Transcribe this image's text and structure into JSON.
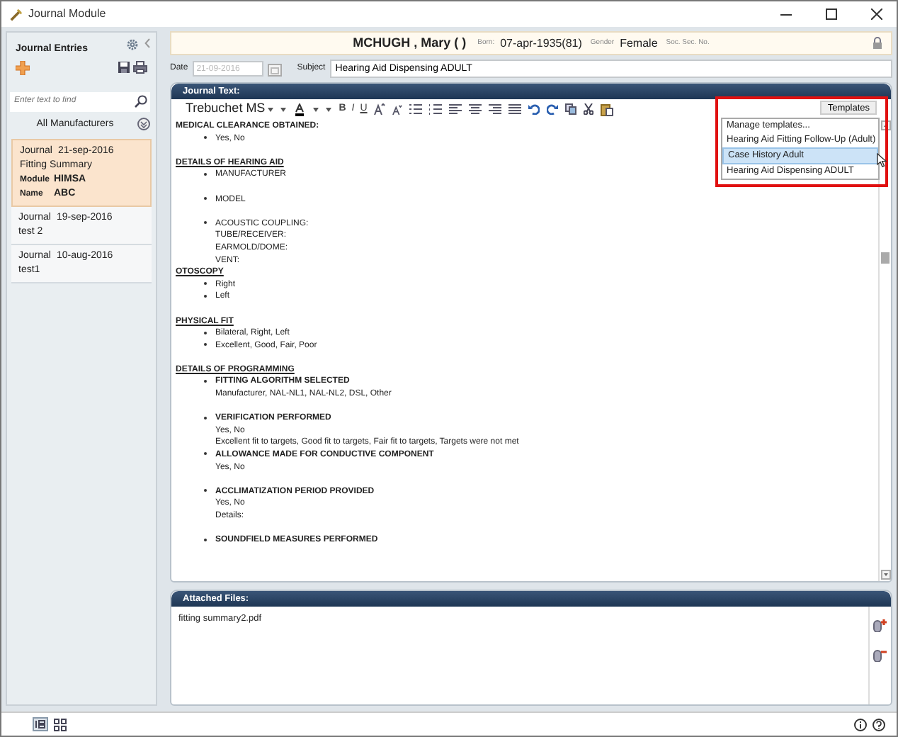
{
  "window": {
    "title": "Journal Module"
  },
  "sidebar": {
    "title": "Journal Entries",
    "search": {
      "placeholder": "Enter text to find"
    },
    "filter": "All Manufacturers",
    "entries": [
      {
        "label": "Journal",
        "date": "21-sep-2016",
        "subject": "Fitting Summary",
        "selected": true,
        "details": [
          {
            "key": "Module",
            "value": "HIMSA"
          },
          {
            "key": "Name",
            "value": "ABC"
          }
        ]
      },
      {
        "label": "Journal",
        "date": "19-sep-2016",
        "subject": "test 2",
        "selected": false
      },
      {
        "label": "Journal",
        "date": "10-aug-2016",
        "subject": "test1",
        "selected": false
      }
    ]
  },
  "patient": {
    "name": "MCHUGH , Mary ( )",
    "born_label": "Born:",
    "born": "07-apr-1935(81)",
    "gender_label": "Gender",
    "gender": "Female",
    "ssn_label": "Soc. Sec. No."
  },
  "date": {
    "label": "Date",
    "value": "21-09-2016",
    "disabled": true
  },
  "subject": {
    "label": "Subject",
    "value": "Hearing Aid Dispensing ADULT"
  },
  "journal_text": {
    "title": "Journal Text:",
    "font": "Trebuchet MS",
    "format_buttons": [
      "B",
      "I",
      "U"
    ],
    "templates": {
      "label": "Templates",
      "items": [
        {
          "text": "Manage templates...",
          "selected": false
        },
        {
          "text": "Hearing Aid Fitting Follow-Up (Adult)",
          "selected": false
        },
        {
          "text": "Case History Adult",
          "selected": true
        },
        {
          "text": "Hearing Aid Dispensing ADULT",
          "selected": false
        }
      ]
    },
    "lines": [
      {
        "kind": "title",
        "text": "MEDICAL CLEARANCE OBTAINED:",
        "gap_before": false
      },
      {
        "kind": "bullet",
        "text": "Yes, No",
        "bold": false,
        "gap_before": false
      },
      {
        "kind": "section",
        "text": "DETAILS OF HEARING AID",
        "gap_before": true
      },
      {
        "kind": "bullet",
        "text": "MANUFACTURER",
        "bold": false,
        "gap_before": false
      },
      {
        "kind": "bullet",
        "text": "MODEL",
        "bold": false,
        "gap_before": true
      },
      {
        "kind": "bullet",
        "text": "ACOUSTIC COUPLING:",
        "bold": false,
        "gap_before": true
      },
      {
        "kind": "text",
        "text": "TUBE/RECEIVER:",
        "gap_before": false
      },
      {
        "kind": "text",
        "text": "EARMOLD/DOME:",
        "gap_before": false
      },
      {
        "kind": "text",
        "text": "VENT:",
        "gap_before": false
      },
      {
        "kind": "section",
        "text": "OTOSCOPY",
        "gap_before": false
      },
      {
        "kind": "bullet",
        "text": "Right",
        "bold": false,
        "gap_before": false
      },
      {
        "kind": "bullet",
        "text": "Left",
        "bold": false,
        "gap_before": false
      },
      {
        "kind": "section",
        "text": "PHYSICAL FIT",
        "gap_before": true
      },
      {
        "kind": "bullet",
        "text": "Bilateral, Right, Left",
        "bold": false,
        "gap_before": false
      },
      {
        "kind": "bullet",
        "text": "Excellent, Good, Fair, Poor",
        "bold": false,
        "gap_before": false
      },
      {
        "kind": "section",
        "text": "DETAILS OF PROGRAMMING",
        "gap_before": true
      },
      {
        "kind": "bullet",
        "text": "FITTING ALGORITHM SELECTED",
        "bold": true,
        "gap_before": false
      },
      {
        "kind": "text",
        "text": "Manufacturer, NAL-NL1, NAL-NL2, DSL, Other",
        "gap_before": false
      },
      {
        "kind": "bullet",
        "text": "VERIFICATION PERFORMED",
        "bold": true,
        "gap_before": true
      },
      {
        "kind": "text",
        "text": "Yes, No",
        "gap_before": false
      },
      {
        "kind": "text",
        "text": "Excellent fit to targets, Good fit to targets, Fair fit to targets, Targets were not met",
        "gap_before": false
      },
      {
        "kind": "bullet",
        "text": "ALLOWANCE MADE FOR CONDUCTIVE COMPONENT",
        "bold": true,
        "gap_before": false
      },
      {
        "kind": "text",
        "text": "Yes, No",
        "gap_before": false
      },
      {
        "kind": "bullet",
        "text": "ACCLIMATIZATION PERIOD PROVIDED",
        "bold": true,
        "gap_before": true
      },
      {
        "kind": "text",
        "text": "Yes, No",
        "gap_before": false
      },
      {
        "kind": "text",
        "text": "Details:",
        "gap_before": false
      },
      {
        "kind": "bullet",
        "text": "SOUNDFIELD MEASURES PERFORMED",
        "bold": true,
        "gap_before": true
      }
    ]
  },
  "attached_files": {
    "title": "Attached Files:",
    "files": [
      "fitting summary2.pdf"
    ]
  }
}
